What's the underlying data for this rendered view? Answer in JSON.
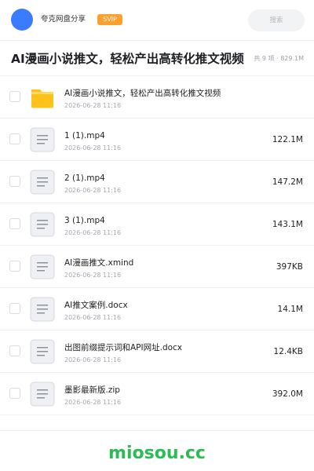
{
  "header": {
    "username": "夸克网盘分享",
    "badge": "SVIP",
    "search_placeholder": "搜索"
  },
  "share": {
    "title": "AI漫画小说推文，轻松产出高转化推文视频",
    "count": "共 9 项 · 829.1M"
  },
  "files": [
    {
      "type": "folder-icon",
      "name": "AI漫画小说推文，轻松产出高转化推文视频",
      "date": "2026-06-28 11:16",
      "size": ""
    },
    {
      "type": "file-icon",
      "name": "1 (1).mp4",
      "date": "2026-06-28 11:16",
      "size": "122.1M"
    },
    {
      "type": "file-icon",
      "name": "2 (1).mp4",
      "date": "2026-06-28 11:16",
      "size": "147.2M"
    },
    {
      "type": "file-icon",
      "name": "3 (1).mp4",
      "date": "2026-06-28 11:16",
      "size": "143.1M"
    },
    {
      "type": "file-icon",
      "name": "AI漫画推文.xmind",
      "date": "2026-06-28 11:16",
      "size": "397KB"
    },
    {
      "type": "file-icon",
      "name": "AI推文案例.docx",
      "date": "2026-06-28 11:16",
      "size": "14.1M"
    },
    {
      "type": "file-icon",
      "name": "出图前缀提示词和API网址.docx",
      "date": "2026-06-28 11:16",
      "size": "12.4KB"
    },
    {
      "type": "file-icon",
      "name": "墨影最新版.zip",
      "date": "2026-06-28 11:16",
      "size": "392.0M"
    }
  ],
  "watermark": "miosou.cc",
  "colors": {
    "accent": "#3b7cff",
    "badge": "#ff9f2e",
    "folder": "#ffc21a",
    "watermark": "#2dbb55"
  }
}
